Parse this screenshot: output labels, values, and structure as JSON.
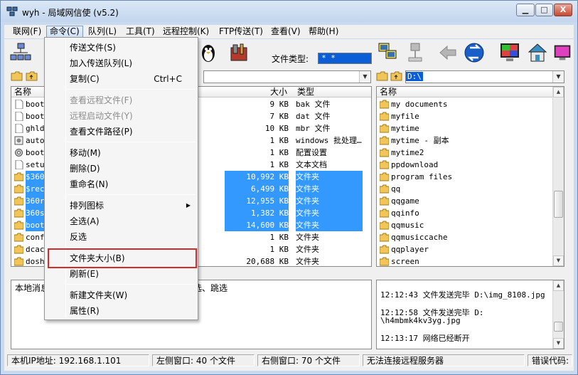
{
  "window": {
    "title": "wyh - 局域网信使 (v5.2)",
    "buttons": {
      "minimize": "▁",
      "maximize": "□",
      "close": "X"
    }
  },
  "menubar": [
    "联网(F)",
    "命令(C)",
    "队列(L)",
    "工具(T)",
    "远程控制(K)",
    "FTP传送(T)",
    "查看(V)",
    "帮助(H)"
  ],
  "toolbar": {
    "file_type_label": "文件类型:",
    "file_type_value": "* *"
  },
  "left_panel": {
    "columns": {
      "name": "名称",
      "size": "大小",
      "type": "类型"
    },
    "rows": [
      {
        "name": "boots",
        "size": "9 KB",
        "type": "bak 文件",
        "icon": "file",
        "selected": false
      },
      {
        "name": "boots",
        "size": "7 KB",
        "type": "dat 文件",
        "icon": "file",
        "selected": false
      },
      {
        "name": "ghldr",
        "size": "10 KB",
        "type": "mbr 文件",
        "icon": "file",
        "selected": false
      },
      {
        "name": "autoe",
        "size": "1 KB",
        "type": "windows 批处理…",
        "icon": "bat",
        "selected": false
      },
      {
        "name": "boot.",
        "size": "1 KB",
        "type": "配置设置",
        "icon": "gear",
        "selected": false
      },
      {
        "name": "setup",
        "size": "1 KB",
        "type": "文本文档",
        "icon": "file",
        "selected": false
      },
      {
        "name": "$360s",
        "size": "10,992 KB",
        "type": "文件夹",
        "icon": "folder",
        "selected": true
      },
      {
        "name": "$recy",
        "size": "6,499 KB",
        "type": "文件夹",
        "icon": "folder",
        "selected": true
      },
      {
        "name": "360re",
        "size": "12,955 KB",
        "type": "文件夹",
        "icon": "folder",
        "selected": true
      },
      {
        "name": "360sa",
        "size": "1,382 KB",
        "type": "文件夹",
        "icon": "folder",
        "selected": true
      },
      {
        "name": "boot",
        "size": "14,600 KB",
        "type": "文件夹",
        "icon": "folder",
        "selected": true
      },
      {
        "name": "confi",
        "size": "1 KB",
        "type": "文件夹",
        "icon": "folder",
        "selected": false
      },
      {
        "name": "dcach",
        "size": "1 KB",
        "type": "文件夹",
        "icon": "folder",
        "selected": false
      },
      {
        "name": "dosh",
        "size": "20,688 KB",
        "type": "文件夹",
        "icon": "folder",
        "selected": false
      }
    ],
    "message_label": "本地消息",
    "message_tail": "选、跳选"
  },
  "right_panel": {
    "path": "D:\\",
    "columns": {
      "name": "名称"
    },
    "rows": [
      "my documents",
      "myfile",
      "mytime",
      "mytime - 副本",
      "mytime2",
      "ppdownload",
      "program files",
      "qq",
      "qqgame",
      "qqinfo",
      "qqmusic",
      "qqmusiccache",
      "qqplayer",
      "screen"
    ],
    "log": [
      {
        "time": "12:12:43",
        "text": "文件发送完毕  D:\\img_8108.jpg"
      },
      {
        "time": "12:12:58",
        "text": "文件发送完毕  D:"
      },
      {
        "time": "",
        "text": "\\h4mbmk4kv3yg.jpg"
      },
      {
        "time": "12:13:17",
        "text": "网络已经断开"
      }
    ]
  },
  "command_menu": {
    "items": [
      {
        "label": "传送文件(S)",
        "shortcut": "",
        "disabled": false
      },
      {
        "label": "加入传送队列(L)",
        "shortcut": "",
        "disabled": false
      },
      {
        "label": "复制(C)",
        "shortcut": "Ctrl+C",
        "disabled": false
      },
      {
        "label": "查看远程文件(F)",
        "shortcut": "",
        "disabled": true
      },
      {
        "label": "远程启动文件(Y)",
        "shortcut": "",
        "disabled": true
      },
      {
        "label": "查看文件路径(P)",
        "shortcut": "",
        "disabled": false
      },
      {
        "label": "移动(M)",
        "shortcut": "",
        "disabled": false
      },
      {
        "label": "删除(D)",
        "shortcut": "",
        "disabled": false
      },
      {
        "label": "重命名(N)",
        "shortcut": "",
        "disabled": false
      },
      {
        "label": "排列图标",
        "shortcut": "",
        "disabled": false,
        "submenu": true
      },
      {
        "label": "全选(A)",
        "shortcut": "",
        "disabled": false
      },
      {
        "label": "反选",
        "shortcut": "",
        "disabled": false
      },
      {
        "label": "文件夹大小(B)",
        "shortcut": "",
        "disabled": false,
        "highlighted": true
      },
      {
        "label": "刷新(E)",
        "shortcut": "",
        "disabled": false
      },
      {
        "label": "新建文件夹(W)",
        "shortcut": "",
        "disabled": false
      },
      {
        "label": "属性(R)",
        "shortcut": "",
        "disabled": false
      }
    ]
  },
  "statusbar": {
    "ip": "本机IP地址: 192.168.1.101",
    "left_window": "左侧窗口: 40 个文件",
    "right_window": "右侧窗口: 70 个文件",
    "connection": "无法连接远程服务器",
    "error": "错误代码:"
  },
  "colors": {
    "selection": "#3399ff",
    "highlight_frame": "#d32a2a",
    "folder": "#f2c55a"
  }
}
